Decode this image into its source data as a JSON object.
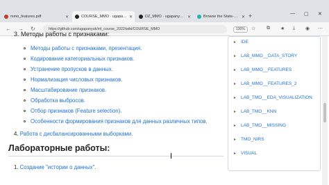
{
  "browser": {
    "tabs": [
      {
        "label": "mmo_features.pdf"
      },
      {
        "label": "COURSE_MMO · ugapanyuk/ml_cour"
      },
      {
        "label": "DZ_MMO · ugapanyuk/ml_course_"
      },
      {
        "label": "Browse the State-of-the-Art in M"
      }
    ],
    "address": "https://github.com/ugapanyuk/ml_course_2022/wiki/COURSE_MMO",
    "zoom": "130%"
  },
  "article": {
    "section3_title": "3. Методы работы с признаками:",
    "section3_items": [
      "Методы работы с признаками, презентация.",
      "Кодирование категориальных признаков.",
      "Устранение пропусков в данных.",
      "Нормализация числовых признаков.",
      "Масштабирование признаков.",
      "Обработка выбросов.",
      "Отбор признаков (Feature selection).",
      "Особенности формирования признаков для данных различных типов."
    ],
    "section4_num": "4.",
    "section4_link": "Работа с дисбалансированными выборками.",
    "labs_title": "Лабораторные работы:",
    "lab1_num": "1.",
    "lab1_link": "Создание \"истории о данных\"."
  },
  "sidebar": {
    "items": [
      "IDE",
      "LAB_MMO__DATA_STORY",
      "LAB_MMO__FEATURES",
      "LAB_MMO__FEATURES_2",
      "LAB_TMO__EDA_VISUALIZATION",
      "LAB_TMO__KNN",
      "LAB_TMO__MISSING",
      "TMO_NIRS",
      "VISUAL"
    ]
  }
}
